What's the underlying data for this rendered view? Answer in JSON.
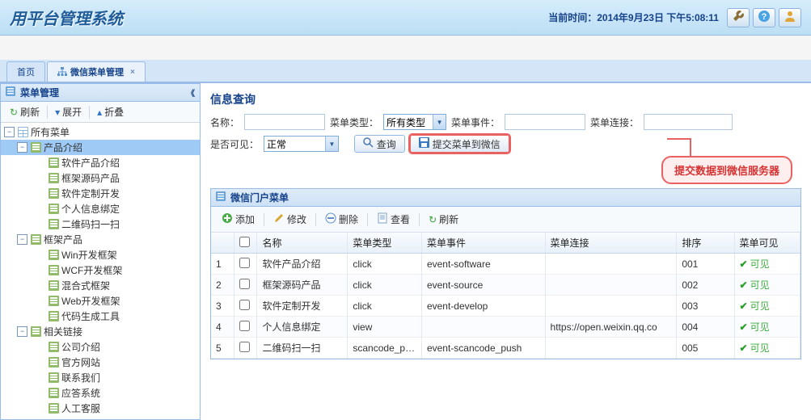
{
  "header": {
    "title": "用平台管理系统",
    "time_label": "当前时间：",
    "time_value": "2014年9月23日 下午5:08:11"
  },
  "tabs": {
    "home": "首页",
    "wx_menu": "微信菜单管理"
  },
  "tree_panel": {
    "title": "菜单管理",
    "refresh": "刷新",
    "expand": "展开",
    "collapse": "折叠",
    "root": "所有菜单",
    "nodes": {
      "product_intro": "产品介绍",
      "soft_product": "软件产品介绍",
      "framework_src": "框架源码产品",
      "soft_custom": "软件定制开发",
      "personal_bind": "个人信息绑定",
      "qrcode_scan": "二维码扫一扫",
      "framework_product": "框架产品",
      "win_frame": "Win开发框架",
      "wcf_frame": "WCF开发框架",
      "hybrid_frame": "混合式框架",
      "web_frame": "Web开发框架",
      "codegen": "代码生成工具",
      "related_links": "相关链接",
      "company_intro": "公司介绍",
      "official_site": "官方网站",
      "contact_us": "联系我们",
      "qa_system": "应答系统",
      "manual_service": "人工客服"
    }
  },
  "query": {
    "section_title": "信息查询",
    "name_label": "名称：",
    "menu_type_label": "菜单类型：",
    "menu_type_value": "所有类型",
    "menu_event_label": "菜单事件：",
    "menu_link_label": "菜单连接：",
    "visible_label": "是否可见：",
    "visible_value": "正常",
    "search_btn": "查询",
    "submit_btn": "提交菜单到微信",
    "callout": "提交数据到微信服务器"
  },
  "grid": {
    "title": "微信门户菜单",
    "toolbar": {
      "add": "添加",
      "edit": "修改",
      "delete": "删除",
      "view": "查看",
      "refresh": "刷新"
    },
    "columns": {
      "name": "名称",
      "type": "菜单类型",
      "event": "菜单事件",
      "link": "菜单连接",
      "order": "排序",
      "visible": "菜单可见"
    },
    "rows": [
      {
        "idx": "1",
        "name": "软件产品介绍",
        "type": "click",
        "event": "event-software",
        "link": "",
        "order": "001",
        "visible": "可见"
      },
      {
        "idx": "2",
        "name": "框架源码产品",
        "type": "click",
        "event": "event-source",
        "link": "",
        "order": "002",
        "visible": "可见"
      },
      {
        "idx": "3",
        "name": "软件定制开发",
        "type": "click",
        "event": "event-develop",
        "link": "",
        "order": "003",
        "visible": "可见"
      },
      {
        "idx": "4",
        "name": "个人信息绑定",
        "type": "view",
        "event": "",
        "link": "https://open.weixin.qq.co",
        "order": "004",
        "visible": "可见"
      },
      {
        "idx": "5",
        "name": "二维码扫一扫",
        "type": "scancode_push",
        "event": "event-scancode_push",
        "link": "",
        "order": "005",
        "visible": "可见"
      }
    ]
  }
}
